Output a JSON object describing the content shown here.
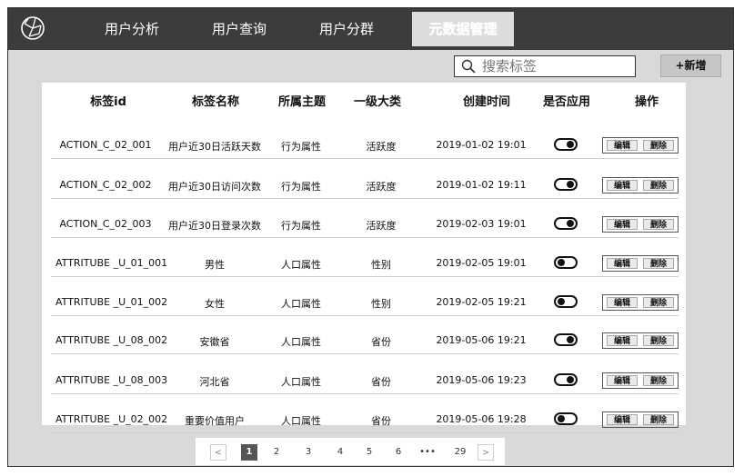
{
  "nav": {
    "logo_icon": "globe-icon",
    "tabs": [
      {
        "label": "用户分析",
        "active": false
      },
      {
        "label": "用户查询",
        "active": false
      },
      {
        "label": "用户分群",
        "active": false
      },
      {
        "label": "元数据管理",
        "active": true
      }
    ]
  },
  "search": {
    "placeholder": "搜索标签",
    "icon": "search-icon"
  },
  "add_button": {
    "label": "+新增"
  },
  "table": {
    "headers": [
      "标签id",
      "标签名称",
      "所属主题",
      "一级大类",
      "创建时间",
      "是否应用",
      "操作"
    ],
    "edit_label": "编辑",
    "delete_label": "删除",
    "rows": [
      {
        "id": "ACTION_C_02_001",
        "name": "用户近30日活跃天数",
        "topic": "行为属性",
        "category": "活跃度",
        "created": "2019-01-02 19:01",
        "applied": true
      },
      {
        "id": "ACTION_C_02_002",
        "name": "用户近30日访问次数",
        "topic": "行为属性",
        "category": "活跃度",
        "created": "2019-01-02 19:11",
        "applied": true
      },
      {
        "id": "ACTION_C_02_003",
        "name": "用户近30日登录次数",
        "topic": "行为属性",
        "category": "活跃度",
        "created": "2019-02-03 19:01",
        "applied": true
      },
      {
        "id": "ATTRITUBE _U_01_001",
        "name": "男性",
        "topic": "人口属性",
        "category": "性别",
        "created": "2019-02-05 19:01",
        "applied": false
      },
      {
        "id": "ATTRITUBE _U_01_002",
        "name": "女性",
        "topic": "人口属性",
        "category": "性别",
        "created": "2019-02-05 19:21",
        "applied": false
      },
      {
        "id": "ATTRITUBE _U_08_002",
        "name": "安徽省",
        "topic": "人口属性",
        "category": "省份",
        "created": "2019-05-06 19:21",
        "applied": true
      },
      {
        "id": "ATTRITUBE _U_08_003",
        "name": "河北省",
        "topic": "人口属性",
        "category": "省份",
        "created": "2019-05-06 19:23",
        "applied": true
      },
      {
        "id": "ATTRITUBE _U_02_002",
        "name": "重要价值用户",
        "topic": "人口属性",
        "category": "省份",
        "created": "2019-05-06 19:28",
        "applied": false
      }
    ]
  },
  "pagination": {
    "prev": "<",
    "pages": [
      "1",
      "2",
      "3",
      "4",
      "5",
      "6",
      "•••",
      "29"
    ],
    "current": "1",
    "next": ">"
  }
}
